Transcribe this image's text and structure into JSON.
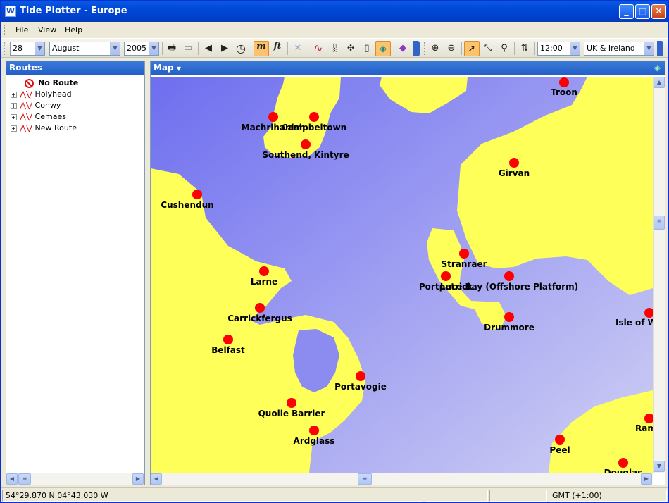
{
  "window": {
    "title": "Tide Plotter - Europe",
    "icon": "app-wave-icon"
  },
  "menu": [
    "File",
    "View",
    "Help"
  ],
  "toolbar": {
    "day": "28",
    "month": "August",
    "year": "2005",
    "time": "12:00",
    "region": "UK & Ireland",
    "icons": [
      "print-icon",
      "print-preview-icon",
      "prev-icon",
      "next-icon",
      "clock-icon",
      "metres-icon",
      "feet-icon",
      "delete-icon",
      "tide-curve-icon",
      "grid-icon",
      "expand-icon",
      "book-icon",
      "map-icon",
      "help-book-icon",
      "zoom-in-icon",
      "zoom-out-icon",
      "pointer-icon",
      "measure-icon",
      "magnify-icon",
      "route-icon"
    ],
    "metres_label": "m",
    "feet_label": "ft"
  },
  "routes": {
    "title": "Routes",
    "items": [
      {
        "label": "No Route",
        "bold": true,
        "icon": "no-route-icon"
      },
      {
        "label": "Holyhead",
        "icon": "route-line-icon"
      },
      {
        "label": "Conwy",
        "icon": "route-line-icon"
      },
      {
        "label": "Cemaes",
        "icon": "route-line-icon"
      },
      {
        "label": "New Route",
        "icon": "route-line-icon"
      }
    ]
  },
  "map": {
    "title": "Map",
    "ports": [
      {
        "name": "Troon"
      },
      {
        "name": "Machrihanish"
      },
      {
        "name": "Campbeltown"
      },
      {
        "name": "Southend, Kintyre"
      },
      {
        "name": "Girvan"
      },
      {
        "name": "Cushendun"
      },
      {
        "name": "Stranraer"
      },
      {
        "name": "Larne"
      },
      {
        "name": "Portpatrick"
      },
      {
        "name": "Luce Bay (Offshore Platform)"
      },
      {
        "name": "Drummore"
      },
      {
        "name": "Carrickfergus"
      },
      {
        "name": "Isle of W"
      },
      {
        "name": "Belfast"
      },
      {
        "name": "Portavogie"
      },
      {
        "name": "Quoile Barrier"
      },
      {
        "name": "Ardglass"
      },
      {
        "name": "Ram"
      },
      {
        "name": "Peel"
      },
      {
        "name": "Douglas"
      }
    ],
    "colors": {
      "land": "#ffff5a",
      "sea_dark": "#6e6ef0",
      "sea_light": "#d0d0f4",
      "marker": "#ff0000"
    }
  },
  "status": {
    "position": "54°29.870 N  04°43.030 W",
    "timezone": "GMT (+1:00)"
  }
}
